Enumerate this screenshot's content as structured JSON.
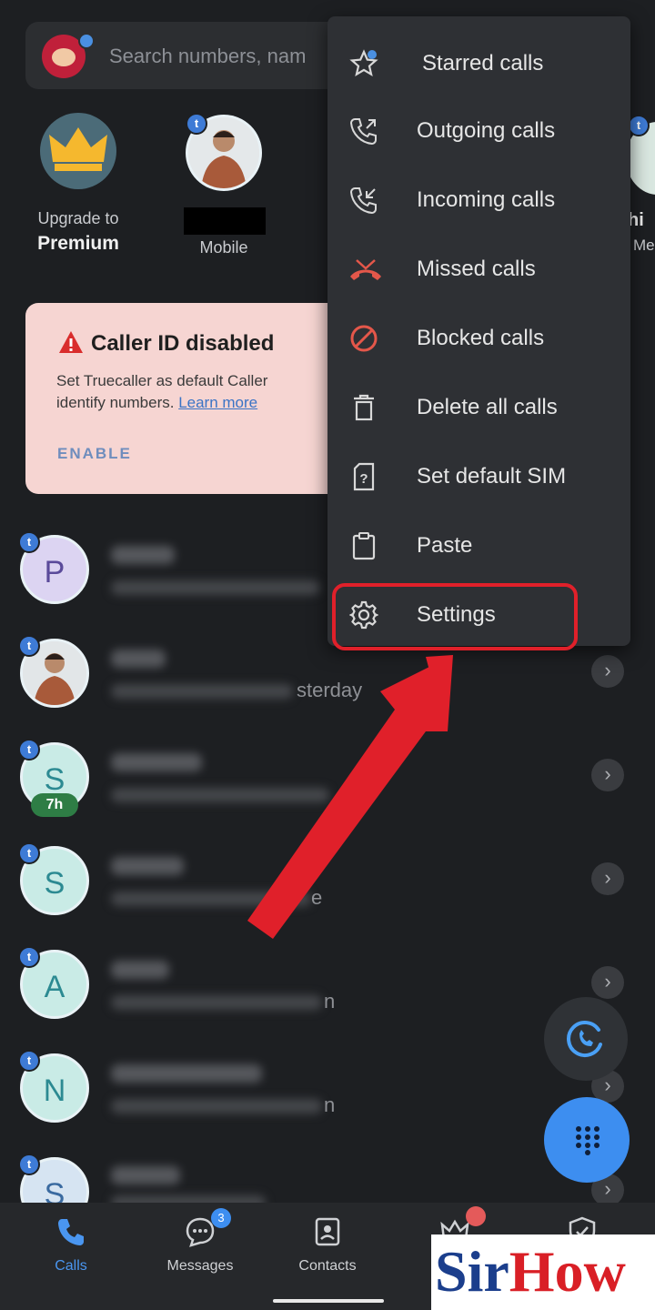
{
  "search": {
    "placeholder": "Search numbers, nam"
  },
  "favorites": [
    {
      "line1": "Upgrade to",
      "line2": "Premium"
    },
    {
      "sub": "Mobile"
    },
    {
      "partial_name": "hi",
      "partial_sub": "Me"
    }
  ],
  "caller_id_card": {
    "title": "Caller ID disabled",
    "body_line1": "Set Truecaller as default Caller",
    "body_line2": "identify numbers.",
    "learn_more": "Learn more",
    "enable": "ENABLE"
  },
  "calls": [
    {
      "initial": "P",
      "sub_tail": ""
    },
    {
      "initial": "",
      "sub_tail": "sterday"
    },
    {
      "initial": "S",
      "badge": "7h",
      "sub_tail": ""
    },
    {
      "initial": "S",
      "sub_tail": "e"
    },
    {
      "initial": "A",
      "sub_tail": "n"
    },
    {
      "initial": "N",
      "sub_tail": "n"
    },
    {
      "initial": "S",
      "sub_tail": ""
    }
  ],
  "menu": {
    "items": [
      {
        "label": "Starred calls",
        "icon": "star-icon"
      },
      {
        "label": "Outgoing calls",
        "icon": "outgoing-call-icon"
      },
      {
        "label": "Incoming calls",
        "icon": "incoming-call-icon"
      },
      {
        "label": "Missed calls",
        "icon": "missed-call-icon"
      },
      {
        "label": "Blocked calls",
        "icon": "blocked-icon"
      },
      {
        "label": "Delete all calls",
        "icon": "trash-icon"
      },
      {
        "label": "Set default SIM",
        "icon": "sim-icon"
      },
      {
        "label": "Paste",
        "icon": "clipboard-icon"
      },
      {
        "label": "Settings",
        "icon": "gear-icon"
      }
    ]
  },
  "nav": {
    "calls": "Calls",
    "messages": "Messages",
    "messages_badge": "3",
    "contacts": "Contacts",
    "premium_partial": "P"
  },
  "watermark": {
    "part1": "Sir",
    "part2": "How"
  },
  "colors": {
    "accent": "#3d8ef0",
    "highlight": "#e0202a",
    "warning": "#d92c2c"
  }
}
